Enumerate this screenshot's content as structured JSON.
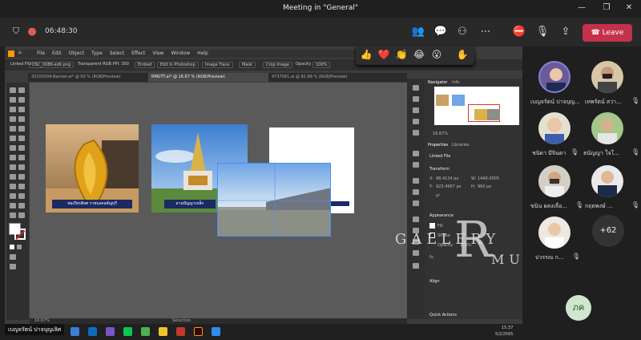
{
  "window": {
    "title": "Meeting in \"General\""
  },
  "meeting": {
    "timer": "06:48:30",
    "leave_label": "Leave",
    "reactions": [
      "👍",
      "❤️",
      "👏",
      "😂",
      "😮",
      "✋"
    ]
  },
  "illustrator": {
    "menu": [
      "File",
      "Edit",
      "Object",
      "Type",
      "Select",
      "Effect",
      "View",
      "Window",
      "Help"
    ],
    "control_bar": [
      "Linked File",
      "DSC_0088-edit.png",
      "Transparent RGB PPI: 300",
      "Embed",
      "Edit In Photoshop",
      "Image Trace",
      "Mask",
      "Crop Image",
      "Opacity",
      "100%"
    ],
    "tabs": [
      "20200204-Banner.ai* @ 50 % (RGB/Preview)",
      "RMUTT.ai* @ 16.67 % (RGB/Preview)",
      "4737581.ai @ 82.89 % (RGB/Preview)"
    ],
    "captions": [
      "หอเกียรติยศ ราชมงคลธัญบุรี",
      "ลานปัญญาเหล็ก"
    ],
    "panel": {
      "navigator_tab": "Navigator",
      "info_tab": "Info",
      "zoom": "16.67%",
      "properties_tab": "Properties",
      "libraries_tab": "Libraries",
      "linked_file": "Linked File",
      "transform": "Transform",
      "x_label": "X:",
      "x_value": "98.4124 px",
      "y_label": "Y:",
      "y_value": "923.4667 px",
      "w_label": "W:",
      "w_value": "1440.0005",
      "h_label": "H:",
      "h_value": "960 px",
      "angle": "0°",
      "appearance": "Appearance",
      "fill": "Fill",
      "stroke": "Stroke",
      "opacity": "Opacity",
      "opacity_value": "100%",
      "fx": "fx.",
      "align": "Align",
      "quick_actions": "Quick Actions"
    },
    "status": {
      "zoom": "16.67%",
      "tool": "Selection"
    }
  },
  "taskbar": {
    "time": "15:37",
    "date": "5/2/2565"
  },
  "presenter_tag": "เบญจรัตน์ ปาจบุญเลิศ",
  "watermark": {
    "top": "GALLERY",
    "letter": "R",
    "bottom": "MUTT"
  },
  "participants": [
    {
      "name": "เบญจรัตน์ ปาจบุญ...",
      "mic_off": false
    },
    {
      "name": "เทพรัตน์ สว่า...",
      "mic_off": true
    },
    {
      "name": "ชนิดา มีจินดา",
      "mic_off": true
    },
    {
      "name": "ธนัญญา ใจใ...",
      "mic_off": true
    },
    {
      "name": "ขนิน ผลงเลื่อ...",
      "mic_off": true
    },
    {
      "name": "กฤตพงษ์ ...",
      "mic_off": true
    },
    {
      "name": "ปวรรณ ก...",
      "mic_off": true
    }
  ],
  "more_participants": "+62",
  "self_initials": "ภค",
  "colors": {
    "leave": "#c4314b",
    "caption": "#1b2a64",
    "accent_ai": "#ff9a00"
  }
}
